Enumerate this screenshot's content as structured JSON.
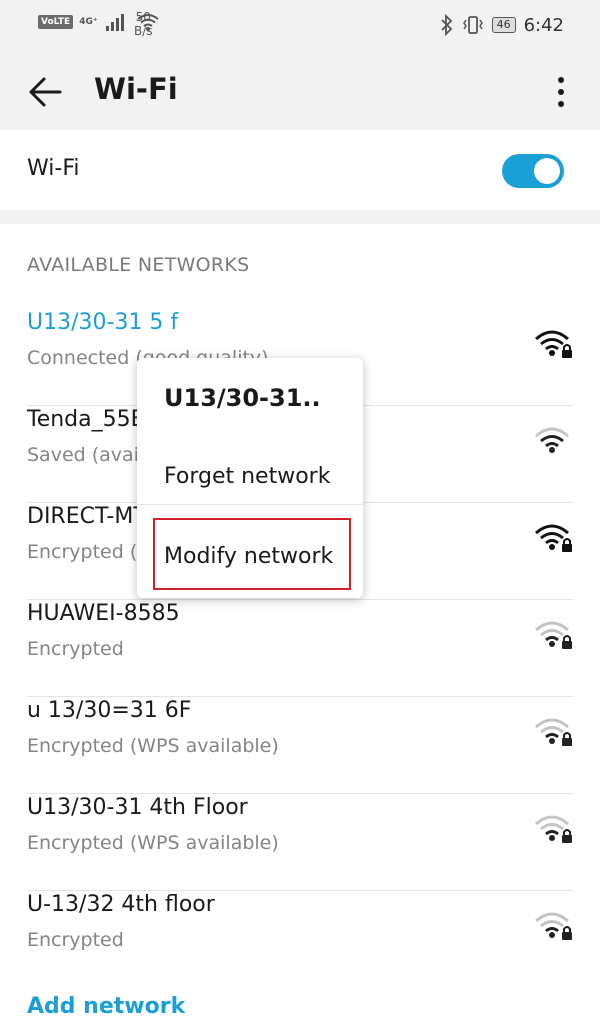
{
  "status_bar": {
    "volte": "VoLTE",
    "network_type": "4G⁺",
    "speed_value": "50",
    "speed_unit": "B/s",
    "battery": "46",
    "time": "6:42"
  },
  "app_bar": {
    "title": "Wi-Fi"
  },
  "wifi_toggle": {
    "label": "Wi-Fi",
    "enabled": true,
    "color": "#1aa0d4"
  },
  "section_header": "AVAILABLE NETWORKS",
  "networks": [
    {
      "name": "U13/30-31 5 f",
      "status": "Connected (good quality)",
      "connected": true,
      "locked": true
    },
    {
      "name": "Tenda_55E",
      "status": "Saved (available)",
      "locked": false
    },
    {
      "name": "DIRECT-MT",
      "status": "Encrypted (WPS available)",
      "locked": true
    },
    {
      "name": "HUAWEI-8585",
      "status": "Encrypted",
      "locked": true
    },
    {
      "name": "u 13/30=31 6F",
      "status": "Encrypted (WPS available)",
      "locked": true
    },
    {
      "name": "U13/30-31 4th Floor",
      "status": "Encrypted (WPS available)",
      "locked": true
    },
    {
      "name": "U-13/32 4th floor",
      "status": "Encrypted",
      "locked": true
    }
  ],
  "add_network": "Add network",
  "context_menu": {
    "title": "U13/30-31..",
    "items": [
      "Forget network",
      "Modify network"
    ],
    "highlighted": "Modify network",
    "highlight_color": "#d0202b"
  }
}
